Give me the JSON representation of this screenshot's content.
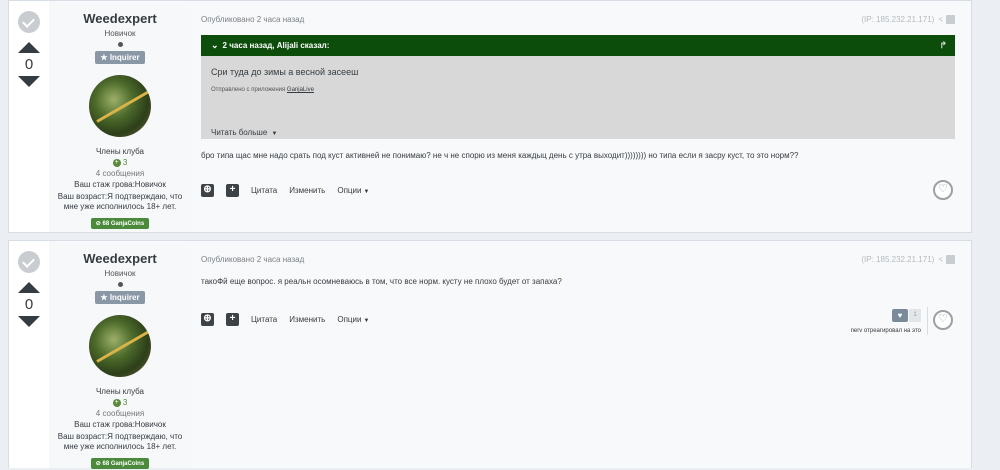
{
  "posts": [
    {
      "votes": "0",
      "author": {
        "name": "Weedexpert",
        "rank": "Новичок",
        "badge": "Inquirer",
        "group": "Члены клуба",
        "reputation": "3",
        "messages": "4 сообщения",
        "field1": "Ваш стаж грова:Новичок",
        "field2": "Ваш возраст:Я подтверждаю, что мне уже исполнилось 18+ лет.",
        "coins": "68 GanjaCoins"
      },
      "meta": "Опубликовано 2 часа назад",
      "ip": "(IP: 185.232.21.171)",
      "quote": {
        "header": "2 часа назад, Alijali сказал:",
        "text": "Сри туда до зимы а весной засееш",
        "sent_from": "Отправлено с приложения",
        "sent_link": "GanjaLive",
        "more": "Читать больше"
      },
      "text": "бро типа щас мне надо срать под куст активней не понимаю? не ч не спорю из меня каждыц день с утра выходит)))))))) но типа если я засру куст, то это норм??",
      "actions": {
        "quote": "Цитата",
        "edit": "Изменить",
        "options": "Опции"
      }
    },
    {
      "votes": "0",
      "author": {
        "name": "Weedexpert",
        "rank": "Новичок",
        "badge": "Inquirer",
        "group": "Члены клуба",
        "reputation": "3",
        "messages": "4 сообщения",
        "field1": "Ваш стаж грова:Новичок",
        "field2": "Ваш возраст:Я подтверждаю, что мне уже исполнилось 18+ лет.",
        "coins": "68 GanjaCoins"
      },
      "meta": "Опубликовано 2 часа назад",
      "ip": "(IP: 185.232.21.171)",
      "text": "такоФй еще вопрос. я реальн осомневаюсь в том, что все норм. кусту не плохо будет от запаха?",
      "actions": {
        "quote": "Цитата",
        "edit": "Изменить",
        "options": "Опции"
      },
      "reaction": {
        "count": "1",
        "text": "nerv отреагировал на это"
      }
    }
  ],
  "colors": {
    "quote_header": "#0c4d0b",
    "coins_badge": "#4a8a3a",
    "rank_badge": "#8a97a6"
  },
  "icons": [
    "checkmark-icon",
    "arrow-up-icon",
    "arrow-down-icon",
    "star-icon",
    "chevron-down-icon",
    "forward-icon",
    "share-icon",
    "heart-icon",
    "plus-icon",
    "multiquote-icon"
  ]
}
